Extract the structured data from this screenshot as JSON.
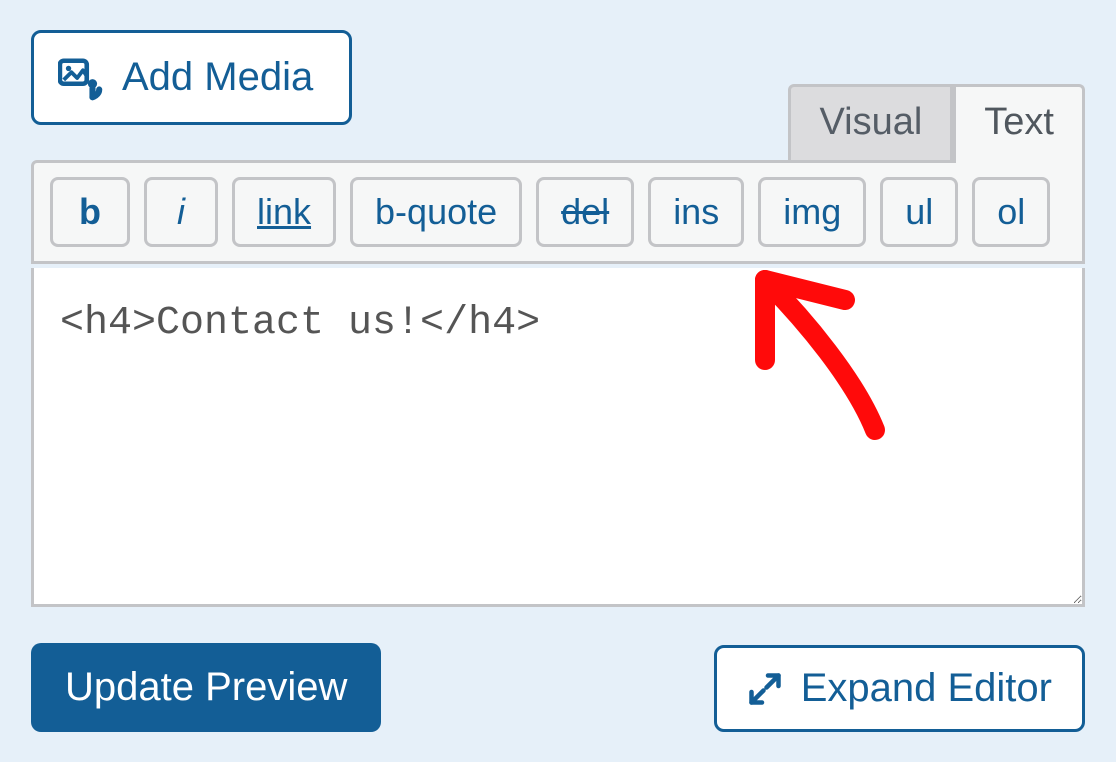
{
  "add_media": {
    "label": "Add Media"
  },
  "tabs": {
    "visual": "Visual",
    "text": "Text",
    "active": "text"
  },
  "toolbar": {
    "b": "b",
    "i": "i",
    "link": "link",
    "bquote": "b-quote",
    "del": "del",
    "ins": "ins",
    "img": "img",
    "ul": "ul",
    "ol": "ol"
  },
  "editor": {
    "content": "<h4>Contact us!</h4>"
  },
  "buttons": {
    "update_preview": "Update Preview",
    "expand_editor": "Expand Editor"
  },
  "colors": {
    "accent": "#135e96",
    "panel_bg": "#e6f0f9",
    "border_gray": "#c3c4c7",
    "toolbar_bg": "#f6f7f7",
    "annotation": "#ff0000"
  }
}
